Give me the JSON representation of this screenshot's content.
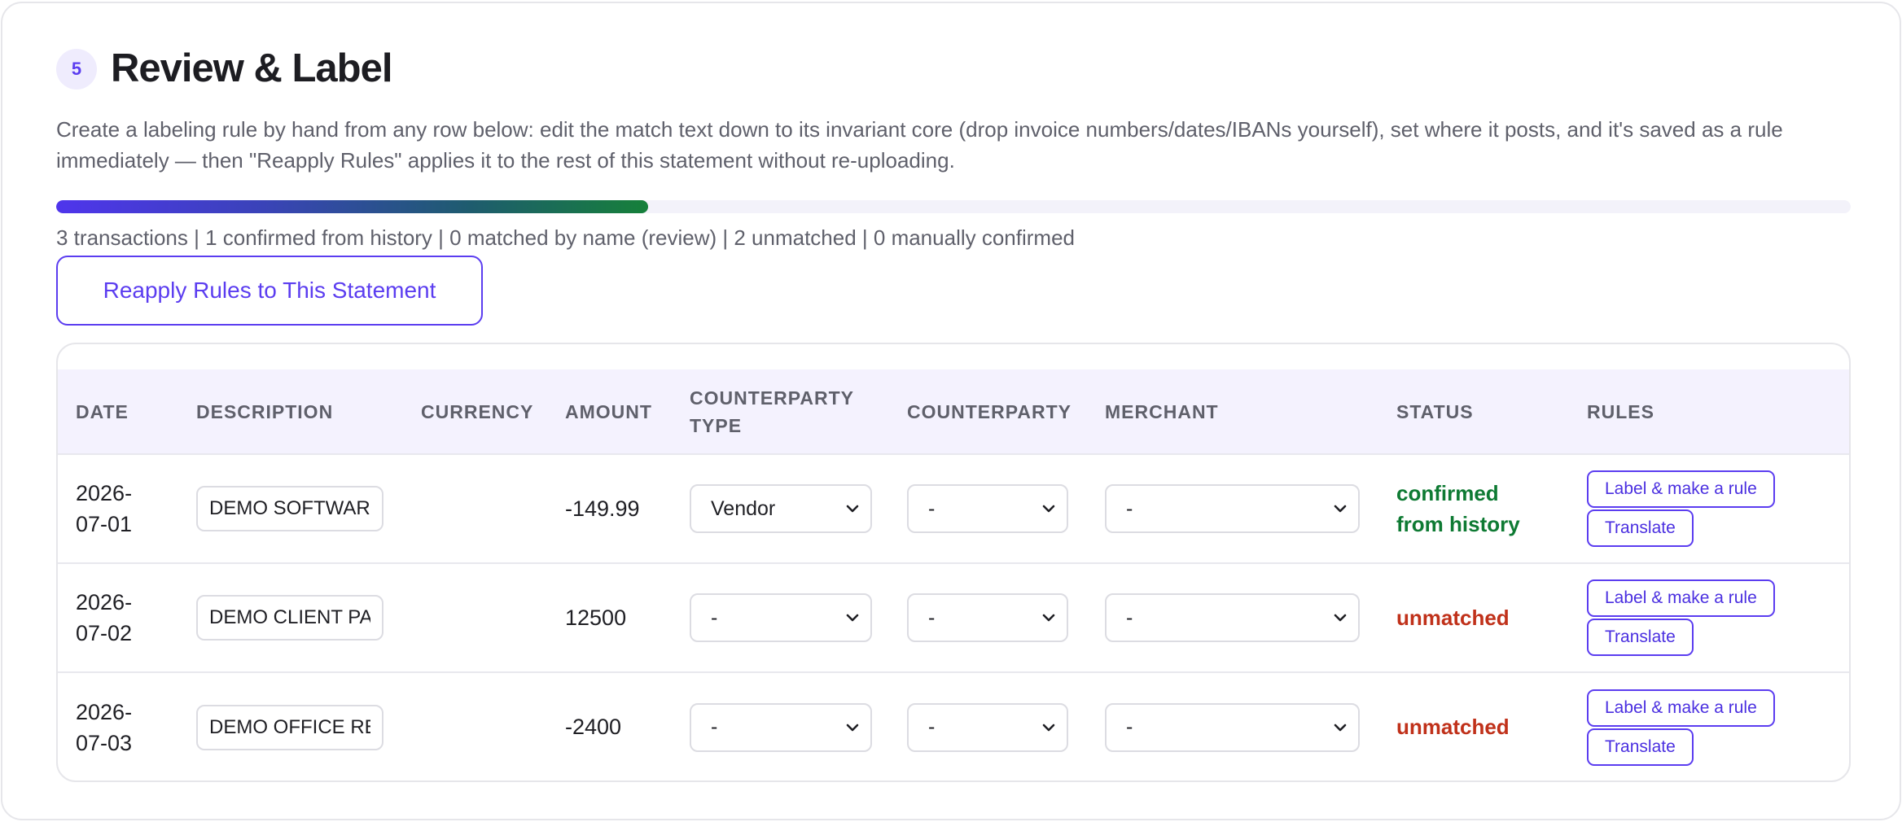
{
  "step": {
    "number": "5"
  },
  "header": {
    "title": "Review & Label"
  },
  "description": "Create a labeling rule by hand from any row below: edit the match text down to its invariant core (drop invoice numbers/dates/IBANs yourself), set where it posts, and it's saved as a rule immediately — then \"Reapply Rules\" applies it to the rest of this statement without re-uploading.",
  "progress": {
    "fraction": 0.33
  },
  "summary": "3 transactions | 1 confirmed from history | 0 matched by name (review) | 2 unmatched | 0 manually confirmed",
  "reapply_label": "Reapply Rules to This Statement",
  "table": {
    "columns": {
      "date": "DATE",
      "description": "DESCRIPTION",
      "currency": "CURRENCY",
      "amount": "AMOUNT",
      "counterparty_type": "COUNTERPARTY TYPE",
      "counterparty": "COUNTERPARTY",
      "merchant": "MERCHANT",
      "status": "STATUS",
      "rules": "RULES"
    },
    "rows": [
      {
        "date_line1": "2026-",
        "date_line2": "07-01",
        "description": "DEMO SOFTWARE",
        "currency": "",
        "amount": "-149.99",
        "counterparty_type": "Vendor",
        "counterparty": "-",
        "merchant": "-",
        "status_line1": "confirmed",
        "status_line2": "from history",
        "label_rule": "Label & make a rule",
        "translate": "Translate"
      },
      {
        "date_line1": "2026-",
        "date_line2": "07-02",
        "description": "DEMO CLIENT PA",
        "currency": "",
        "amount": "12500",
        "counterparty_type": "-",
        "counterparty": "-",
        "merchant": "-",
        "status": "unmatched",
        "label_rule": "Label & make a rule",
        "translate": "Translate"
      },
      {
        "date_line1": "2026-",
        "date_line2": "07-03",
        "description": "DEMO OFFICE RE",
        "currency": "",
        "amount": "-2400",
        "counterparty_type": "-",
        "counterparty": "-",
        "merchant": "-",
        "status": "unmatched",
        "label_rule": "Label & make a rule",
        "translate": "Translate"
      }
    ]
  },
  "colors": {
    "accent": "#5b3df0",
    "confirmed": "#0e7a33",
    "unmatched": "#c0311a"
  }
}
